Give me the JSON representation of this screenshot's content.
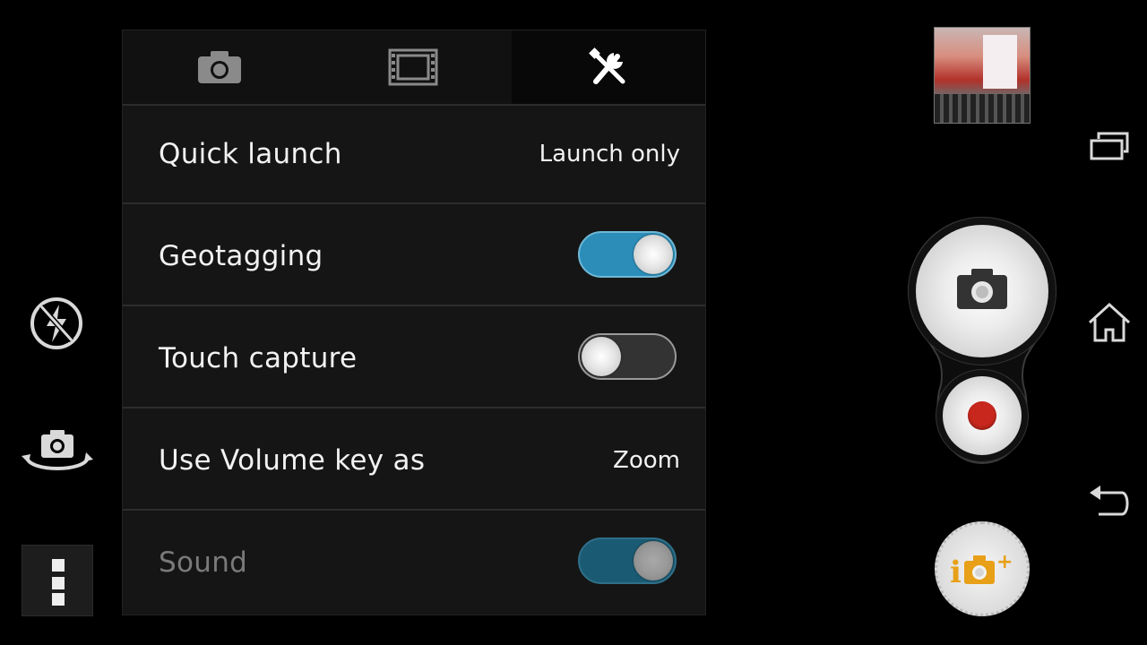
{
  "left_controls": {
    "flash_icon": "flash-off-icon",
    "switch_camera_icon": "switch-camera-icon",
    "menu_icon": "overflow-menu-icon"
  },
  "settings": {
    "tabs": [
      {
        "id": "camera",
        "icon": "camera-icon",
        "active": false
      },
      {
        "id": "video",
        "icon": "film-icon",
        "active": false
      },
      {
        "id": "tools",
        "icon": "tools-icon",
        "active": true
      }
    ],
    "rows": [
      {
        "label": "Quick launch",
        "value": "Launch only",
        "type": "value"
      },
      {
        "label": "Geotagging",
        "type": "toggle",
        "state": "on"
      },
      {
        "label": "Touch capture",
        "type": "toggle",
        "state": "off"
      },
      {
        "label": "Use Volume key as",
        "value": "Zoom",
        "type": "value"
      },
      {
        "label": "Sound",
        "type": "toggle",
        "state": "on",
        "enabled": false
      }
    ]
  },
  "right_controls": {
    "thumbnail": "last-photo-thumbnail",
    "photo_button_icon": "camera-icon",
    "video_button_icon": "record-icon",
    "apps_button_icon": "camera-apps-icon"
  },
  "system_nav": {
    "recents_icon": "recents-icon",
    "home_icon": "home-icon",
    "back_icon": "back-icon"
  },
  "colors": {
    "toggle_on": "#2b8db8",
    "record": "#c8271d",
    "apps_accent": "#e8a018"
  }
}
